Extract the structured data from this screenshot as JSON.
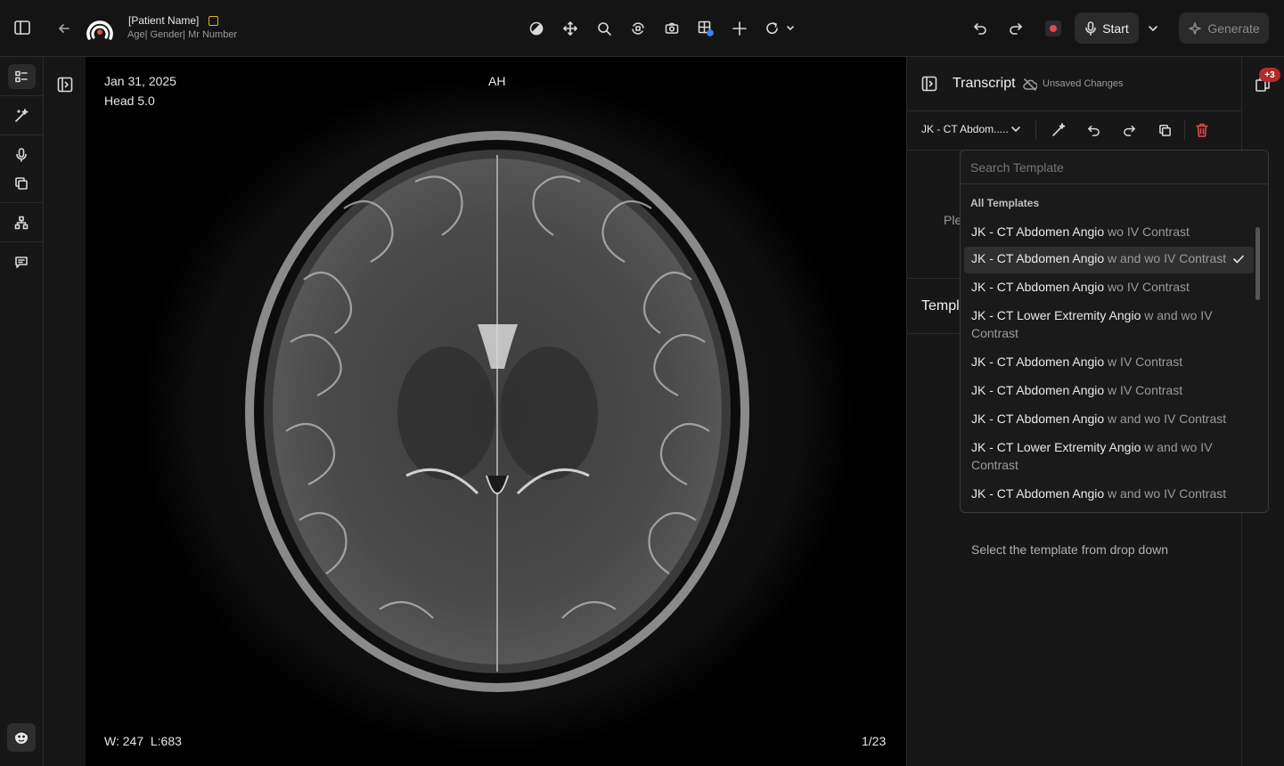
{
  "header": {
    "patient_name": "[Patient Name]",
    "patient_meta": "Age| Gender| Mr Number",
    "start_label": "Start",
    "generate_label": "Generate",
    "icons": [
      "sidebar-toggle-icon",
      "back-arrow-icon",
      "app-logo-icon",
      "contrast-icon",
      "pan-icon",
      "zoom-icon",
      "rotate-3d-icon",
      "camera-icon",
      "layout-grid-icon",
      "crosshair-icon",
      "refresh-icon",
      "undo-icon",
      "redo-icon",
      "record-icon",
      "microphone-icon"
    ],
    "accent_color": "#e54848",
    "flag_color": "#e0b030"
  },
  "left_rail": {
    "items": [
      "list-icon",
      "magic-wand-icon",
      "microphone-icon",
      "copy-icon",
      "hierarchy-icon",
      "chat-icon",
      "avatar-icon"
    ]
  },
  "viewer": {
    "date": "Jan 31, 2025",
    "series": "Head 5.0",
    "orientation": "AH",
    "window_level": "W: 247  L:683",
    "frame": "1/23"
  },
  "transcript": {
    "title": "Transcript",
    "unsaved": "Unsaved Changes",
    "template_selected": "JK - CT Abdom.....",
    "notification_count": "+3",
    "partial_text_1": "Ple",
    "partial_text_2": "Templ",
    "hint": "Select the template from drop down"
  },
  "dropdown": {
    "search_placeholder": "Search Template",
    "section_label": "All Templates",
    "items": [
      {
        "bold": "JK - CT Abdomen Angio",
        "rest": " wo IV Contrast",
        "selected": false
      },
      {
        "bold": "JK - CT Abdomen Angio",
        "rest": " w and wo IV Contrast",
        "selected": true
      },
      {
        "bold": "JK - CT Abdomen Angio",
        "rest": " wo IV Contrast",
        "selected": false
      },
      {
        "bold": "JK - CT Lower Extremity Angio",
        "rest": " w and wo IV Contrast",
        "selected": false
      },
      {
        "bold": "JK - CT Abdomen Angio",
        "rest": " w IV Contrast",
        "selected": false
      },
      {
        "bold": "JK - CT Abdomen Angio",
        "rest": " w IV Contrast",
        "selected": false
      },
      {
        "bold": "JK - CT Abdomen Angio",
        "rest": " w and wo IV Contrast",
        "selected": false
      },
      {
        "bold": "JK - CT Lower Extremity Angio",
        "rest": " w and wo IV Contrast",
        "selected": false
      },
      {
        "bold": "JK - CT Abdomen Angio",
        "rest": " w and wo IV Contrast",
        "selected": false
      }
    ]
  }
}
